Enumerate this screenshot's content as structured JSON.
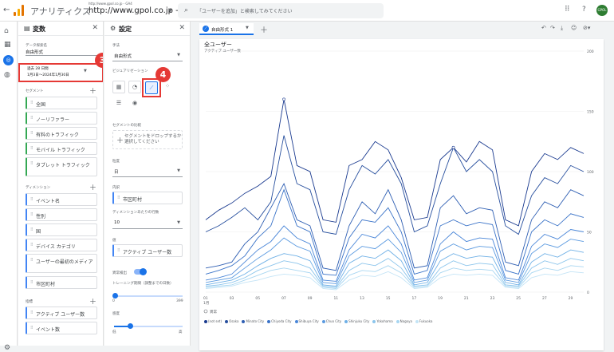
{
  "topbar": {
    "app_name": "アナリティクス",
    "url_small": "http://www.gpol.co.jp - GA4",
    "url_big": "http://www.gpol.co.jp - GA4",
    "search_placeholder": "「ユーザーを追加」と検索してみてください",
    "avatar": "GPOL"
  },
  "variables": {
    "title": "変数",
    "exploration_label": "データ探索名",
    "exploration_name": "自由形式",
    "date_label": "過去 28 日間",
    "date_range": "1月3日～2024年1月30日",
    "segments_heading": "セグメント",
    "segments": [
      "全国",
      "ノーリファラー",
      "有料のトラフィック",
      "モバイル トラフィック",
      "タブレット トラフィック"
    ],
    "dimensions_heading": "ディメンション",
    "dimensions": [
      "イベント名",
      "性別",
      "国",
      "デバイス カテゴリ",
      "ユーザーの最初のメディア",
      "市区町村"
    ],
    "metrics_heading": "指標",
    "metrics": [
      "アクティブ ユーザー数",
      "イベント数"
    ]
  },
  "settings": {
    "title": "設定",
    "technique_label": "手法",
    "technique_value": "自由形式",
    "visualization_label": "ビジュアリゼーション",
    "segment_compare_label": "セグメントの比較",
    "segment_drop_text": "セグメントをドロップするか選択してください",
    "rows_label": "粒度",
    "rows_value": "日",
    "breakdown_label": "内訳",
    "breakdown_value": "市区町村",
    "rows_per_dim_label": "ディメンションあたりの行数",
    "rows_per_dim_value": "10",
    "values_label": "値",
    "values_value": "アクティブ ユーザー数",
    "anomaly_label": "異常検出",
    "training_label": "トレーニング期間（調整までの日数）",
    "training_min": "0",
    "training_max": "399",
    "sensitivity_label": "感度",
    "sens_low": "低",
    "sens_high": "高"
  },
  "annotations": {
    "badge_3": "3",
    "badge_4": "4"
  },
  "tab": {
    "label": "自由形式 1"
  },
  "chart_data": {
    "type": "line",
    "title": "全ユーザー",
    "subtitle": "アクティブ ユーザー数",
    "ylim": [
      0,
      200
    ],
    "yticks": [
      "200",
      "150",
      "100",
      "50",
      "0"
    ],
    "x": [
      "01",
      "03",
      "05",
      "07",
      "09",
      "11",
      "13",
      "15",
      "17",
      "19",
      "21",
      "23",
      "25",
      "27",
      "29"
    ],
    "x_sub": "1月",
    "anomaly_label": "異常",
    "series": [
      {
        "name": "(not set)",
        "color": "#1a3a8f",
        "values": [
          60,
          68,
          74,
          82,
          88,
          96,
          160,
          105,
          100,
          60,
          58,
          105,
          110,
          125,
          118,
          95,
          60,
          62,
          110,
          120,
          108,
          125,
          118,
          60,
          55,
          100,
          115,
          110,
          120,
          115
        ]
      },
      {
        "name": "Osaka",
        "color": "#274f9e",
        "values": [
          50,
          55,
          62,
          70,
          60,
          75,
          130,
          90,
          85,
          50,
          48,
          85,
          105,
          98,
          110,
          90,
          50,
          55,
          90,
          120,
          100,
          110,
          100,
          55,
          48,
          80,
          95,
          90,
          105,
          100
        ]
      },
      {
        "name": "Minato City",
        "color": "#2f5fb3",
        "values": [
          20,
          22,
          25,
          40,
          50,
          70,
          90,
          60,
          55,
          20,
          18,
          55,
          75,
          65,
          85,
          60,
          20,
          22,
          70,
          80,
          65,
          70,
          68,
          25,
          22,
          60,
          75,
          70,
          85,
          80
        ]
      },
      {
        "name": "Chiyoda City",
        "color": "#3a73c8",
        "values": [
          15,
          18,
          22,
          30,
          45,
          55,
          85,
          55,
          50,
          15,
          14,
          45,
          60,
          58,
          70,
          50,
          15,
          18,
          55,
          60,
          55,
          58,
          56,
          18,
          15,
          50,
          60,
          55,
          65,
          62
        ]
      },
      {
        "name": "Shibuya City",
        "color": "#4a86d8",
        "values": [
          10,
          12,
          15,
          25,
          35,
          42,
          55,
          45,
          40,
          10,
          9,
          35,
          48,
          45,
          55,
          40,
          10,
          12,
          40,
          50,
          42,
          45,
          44,
          12,
          10,
          38,
          48,
          44,
          52,
          50
        ]
      },
      {
        "name": "Chuo City",
        "color": "#5b9ae0",
        "values": [
          8,
          10,
          12,
          20,
          28,
          35,
          45,
          38,
          34,
          8,
          7,
          30,
          38,
          36,
          44,
          33,
          8,
          10,
          34,
          40,
          35,
          38,
          37,
          10,
          8,
          32,
          40,
          37,
          44,
          42
        ]
      },
      {
        "name": "Shinjuku City",
        "color": "#6fb0e6",
        "values": [
          6,
          8,
          10,
          15,
          22,
          28,
          32,
          30,
          26,
          6,
          5,
          24,
          30,
          28,
          35,
          26,
          6,
          8,
          26,
          32,
          28,
          30,
          29,
          8,
          6,
          25,
          32,
          29,
          35,
          33
        ]
      },
      {
        "name": "Yokohama",
        "color": "#8cc5ec",
        "values": [
          5,
          6,
          8,
          12,
          18,
          22,
          26,
          24,
          20,
          5,
          4,
          18,
          24,
          22,
          28,
          20,
          5,
          6,
          20,
          26,
          22,
          24,
          23,
          6,
          5,
          20,
          26,
          23,
          28,
          26
        ]
      },
      {
        "name": "Nagoya",
        "color": "#a8d6f1",
        "values": [
          4,
          5,
          6,
          10,
          14,
          18,
          20,
          18,
          16,
          4,
          3,
          14,
          18,
          17,
          22,
          16,
          4,
          5,
          16,
          20,
          18,
          19,
          18,
          5,
          4,
          16,
          20,
          18,
          22,
          21
        ]
      },
      {
        "name": "Fukuoka",
        "color": "#c4e4f6",
        "values": [
          3,
          4,
          5,
          8,
          10,
          13,
          15,
          14,
          12,
          3,
          2,
          10,
          14,
          13,
          17,
          12,
          3,
          4,
          12,
          15,
          14,
          15,
          14,
          4,
          3,
          12,
          15,
          14,
          17,
          16
        ]
      }
    ]
  }
}
